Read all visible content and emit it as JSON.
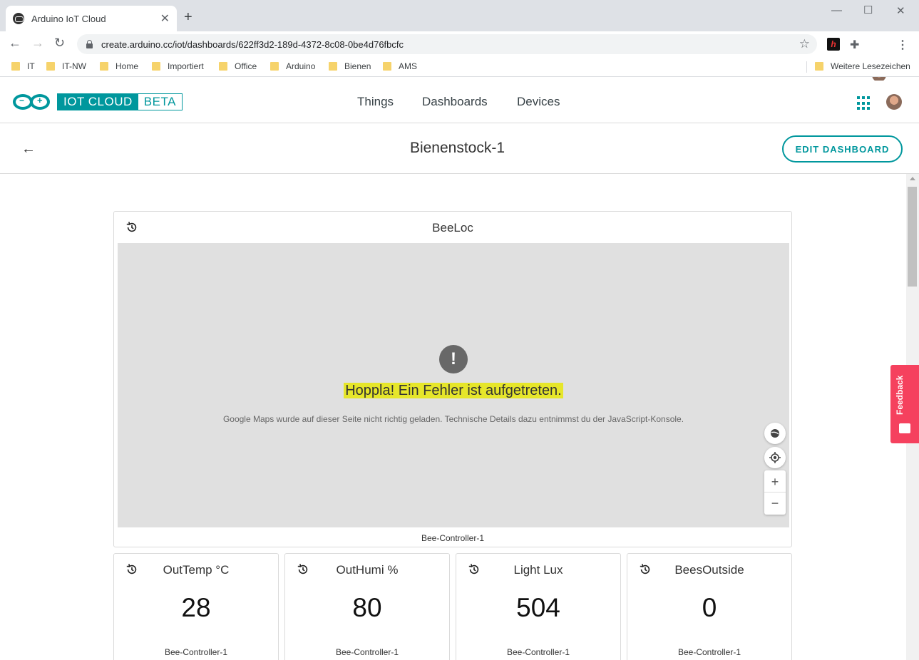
{
  "browser": {
    "tab_title": "Arduino IoT Cloud",
    "url": "create.arduino.cc/iot/dashboards/622ff3d2-189d-4372-8c08-0be4d76fbcfc",
    "bookmarks": [
      "IT",
      "IT-NW",
      "Home",
      "Importiert",
      "Office",
      "Arduino",
      "Bienen",
      "AMS"
    ],
    "other_bookmarks": "Weitere Lesezeichen"
  },
  "app": {
    "logo_a": "IOT CLOUD",
    "logo_b": "BETA",
    "nav": [
      "Things",
      "Dashboards",
      "Devices"
    ],
    "brand_color": "#00979d"
  },
  "page": {
    "title": "Bienenstock-1",
    "edit_button": "EDIT DASHBOARD"
  },
  "map_widget": {
    "title": "BeeLoc",
    "error_title": "Hoppla! Ein Fehler ist aufgetreten.",
    "error_desc": "Google Maps wurde auf dieser Seite nicht richtig geladen. Technische Details dazu entnimmst du der JavaScript-Konsole.",
    "footer": "Bee-Controller-1"
  },
  "value_widgets": [
    {
      "title": "OutTemp °C",
      "value": "28",
      "footer": "Bee-Controller-1"
    },
    {
      "title": "OutHumi %",
      "value": "80",
      "footer": "Bee-Controller-1"
    },
    {
      "title": "Light Lux",
      "value": "504",
      "footer": "Bee-Controller-1"
    },
    {
      "title": "BeesOutside",
      "value": "0",
      "footer": "Bee-Controller-1"
    }
  ],
  "feedback_label": "Feedback"
}
